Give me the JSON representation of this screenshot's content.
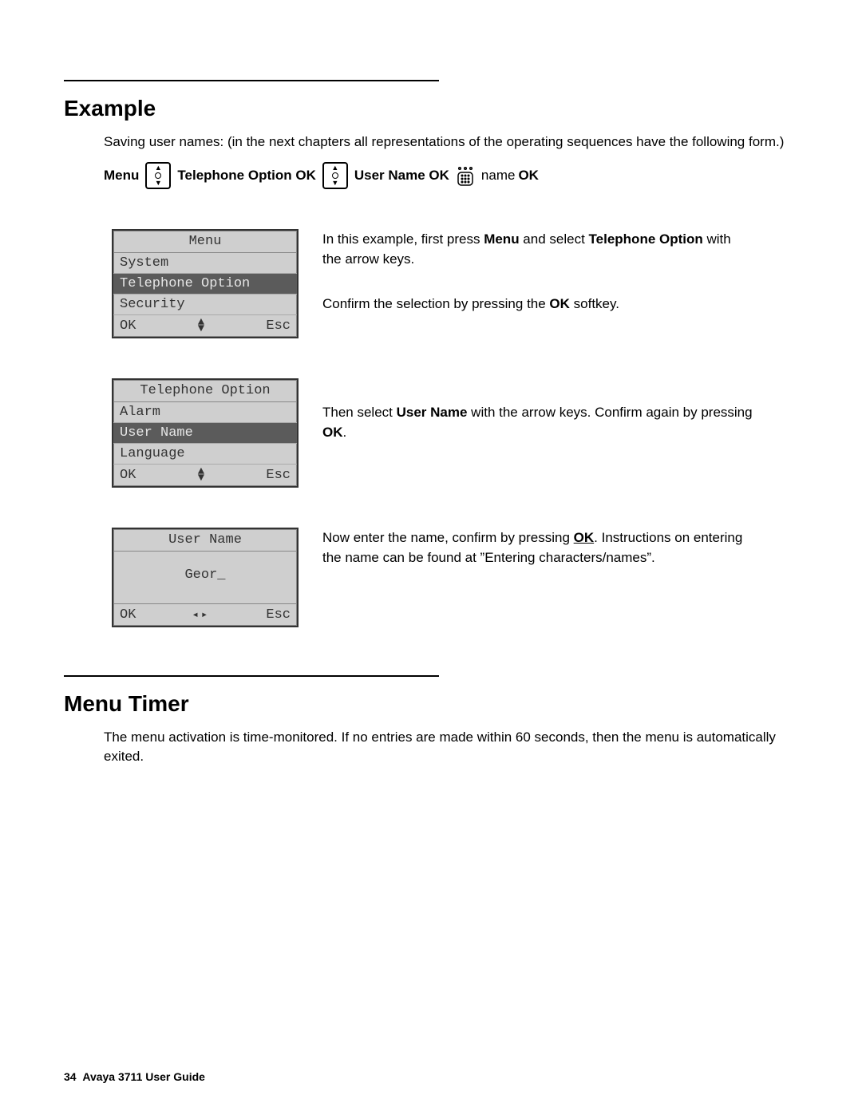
{
  "sections": {
    "example_heading": "Example",
    "example_intro": "Saving user names: (in the next chapters all representations of the operating sequences have the following form.)",
    "menutimer_heading": "Menu Timer",
    "menutimer_body": "The menu activation is time-monitored. If no entries are made within 60 seconds, then the menu is automatically exited."
  },
  "sequence": {
    "p1": "Menu",
    "p2": "Telephone Option OK",
    "p3": "User Name  OK",
    "p4_plain": "name",
    "p5": "OK"
  },
  "screens": {
    "menu": {
      "title": "Menu",
      "items": [
        "System",
        "Telephone Option",
        "Security"
      ],
      "selected_index": 1,
      "sk_left": "OK",
      "sk_right": "Esc"
    },
    "teloption": {
      "title": "Telephone Option",
      "items": [
        "Alarm",
        "User Name",
        "Language"
      ],
      "selected_index": 1,
      "sk_left": "OK",
      "sk_right": "Esc"
    },
    "username": {
      "title": "User Name",
      "input": "Geor_",
      "sk_left": "OK",
      "sk_right": "Esc"
    }
  },
  "explain": {
    "e1a": "In this example, first press ",
    "e1b": "Menu",
    "e1c": " and select ",
    "e1d": "Telephone Option",
    "e1e": " with the arrow keys.",
    "e1f": "Confirm the selection by pressing the ",
    "e1g": "OK",
    "e1h": " softkey.",
    "e2a": "Then select ",
    "e2b": "User Name",
    "e2c": " with the arrow keys. Confirm again by pressing ",
    "e2d": "OK",
    "e2e": ".",
    "e3a": "Now enter the name, confirm by pressing ",
    "e3b": "OK",
    "e3c": ". Instructions on entering the name can be found at ”Entering characters/names”."
  },
  "footer": {
    "page_num": "34",
    "title": "Avaya 3711 User Guide"
  }
}
